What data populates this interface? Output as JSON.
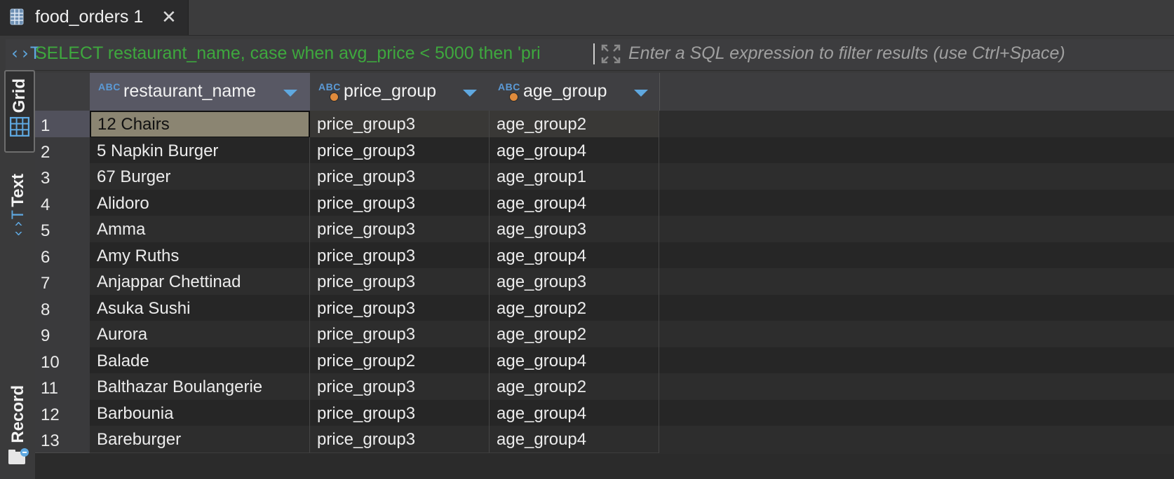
{
  "tab": {
    "title": "food_orders 1",
    "close": "✕"
  },
  "filter": {
    "sql": "SELECT restaurant_name, case when avg_price < 5000 then 'pri",
    "placeholder": "Enter a SQL expression to filter results (use Ctrl+Space)"
  },
  "side": {
    "grid": "Grid",
    "text": "Text",
    "record": "Record"
  },
  "columns": [
    {
      "type": "ABC",
      "name": "restaurant_name"
    },
    {
      "type": "ABC",
      "name": "price_group"
    },
    {
      "type": "ABC",
      "name": "age_group"
    }
  ],
  "rows": [
    {
      "n": "1",
      "restaurant_name": "12 Chairs",
      "price_group": "price_group3",
      "age_group": "age_group2"
    },
    {
      "n": "2",
      "restaurant_name": "5 Napkin Burger",
      "price_group": "price_group3",
      "age_group": "age_group4"
    },
    {
      "n": "3",
      "restaurant_name": "67 Burger",
      "price_group": "price_group3",
      "age_group": "age_group1"
    },
    {
      "n": "4",
      "restaurant_name": "Alidoro",
      "price_group": "price_group3",
      "age_group": "age_group4"
    },
    {
      "n": "5",
      "restaurant_name": "Amma",
      "price_group": "price_group3",
      "age_group": "age_group3"
    },
    {
      "n": "6",
      "restaurant_name": "Amy Ruths",
      "price_group": "price_group3",
      "age_group": "age_group4"
    },
    {
      "n": "7",
      "restaurant_name": "Anjappar Chettinad",
      "price_group": "price_group3",
      "age_group": "age_group3"
    },
    {
      "n": "8",
      "restaurant_name": "Asuka Sushi",
      "price_group": "price_group3",
      "age_group": "age_group2"
    },
    {
      "n": "9",
      "restaurant_name": "Aurora",
      "price_group": "price_group3",
      "age_group": "age_group2"
    },
    {
      "n": "10",
      "restaurant_name": "Balade",
      "price_group": "price_group2",
      "age_group": "age_group4"
    },
    {
      "n": "11",
      "restaurant_name": "Balthazar Boulangerie",
      "price_group": "price_group3",
      "age_group": "age_group2"
    },
    {
      "n": "12",
      "restaurant_name": "Barbounia",
      "price_group": "price_group3",
      "age_group": "age_group4"
    },
    {
      "n": "13",
      "restaurant_name": "Bareburger",
      "price_group": "price_group3",
      "age_group": "age_group4"
    }
  ],
  "colors": {
    "accent": "#5fa8e0",
    "sql_text": "#3ea83e",
    "key_dot": "#e08b3c"
  },
  "icons": {
    "tab": "table-icon",
    "filter": "sql-text-icon",
    "expand": "expand-icon",
    "grid": "grid-icon",
    "text": "text-icon",
    "record": "record-icon"
  }
}
